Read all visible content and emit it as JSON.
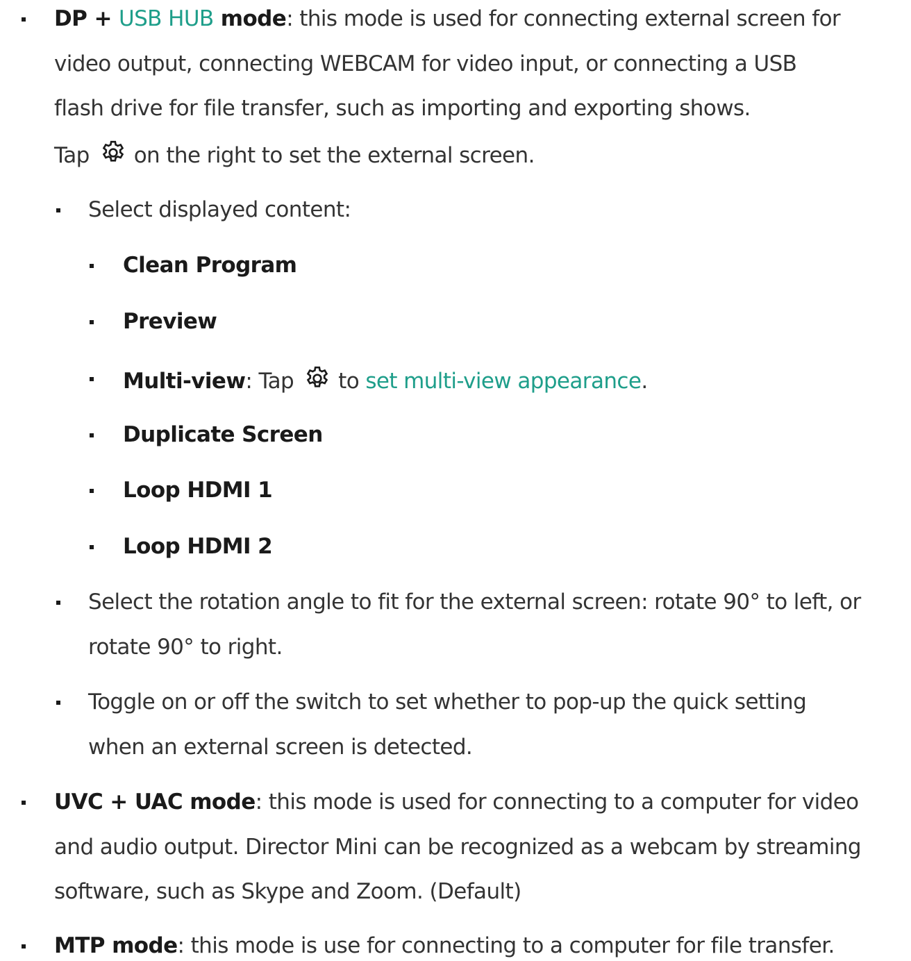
{
  "dp_mode": {
    "term_prefix": "DP + ",
    "term_link": "USB HUB",
    "term_suffix": " mode",
    "desc_line1": ": this mode is used for connecting external screen for",
    "desc_line2": "video output, connecting WEBCAM for video input, or connecting a USB",
    "desc_line3": "flash drive for file transfer, such as importing and exporting shows.",
    "tap_text": "Tap",
    "tap_suffix": "on the right to set the external screen.",
    "icon": "gear-icon"
  },
  "sub_items": {
    "display_label": "Select displayed content:",
    "contents": {
      "clean_program": "Clean Program",
      "preview": "Preview",
      "multiview_label": "Multi-view",
      "multiview_tap": ": Tap",
      "multiview_to": "to",
      "multiview_link": "set multi-view appearance",
      "multiview_end": ".",
      "duplicate": "Duplicate Screen",
      "loop1": "Loop HDMI 1",
      "loop2": "Loop HDMI 2"
    },
    "rotation_line1": "Select the rotation angle to fit for the external screen: rotate 90° to left, or",
    "rotation_line2": "rotate 90° to right.",
    "toggle_line1": "Toggle on or off the switch to set whether to pop-up the quick setting",
    "toggle_line2": "when an external screen is detected."
  },
  "uvc_mode": {
    "term": "UVC + UAC mode",
    "line1": ": this mode is used for connecting to a computer for video",
    "line2": "and audio output. Director Mini can be recognized as a webcam by streaming",
    "line3": "software, such as Skype and Zoom. (Default)"
  },
  "mtp_mode": {
    "term": "MTP mode",
    "line1": ": this mode is use for connecting to a computer for file transfer."
  },
  "colors": {
    "link": "#1e9e8a",
    "text": "#333333",
    "bold": "#1a1a1a"
  }
}
